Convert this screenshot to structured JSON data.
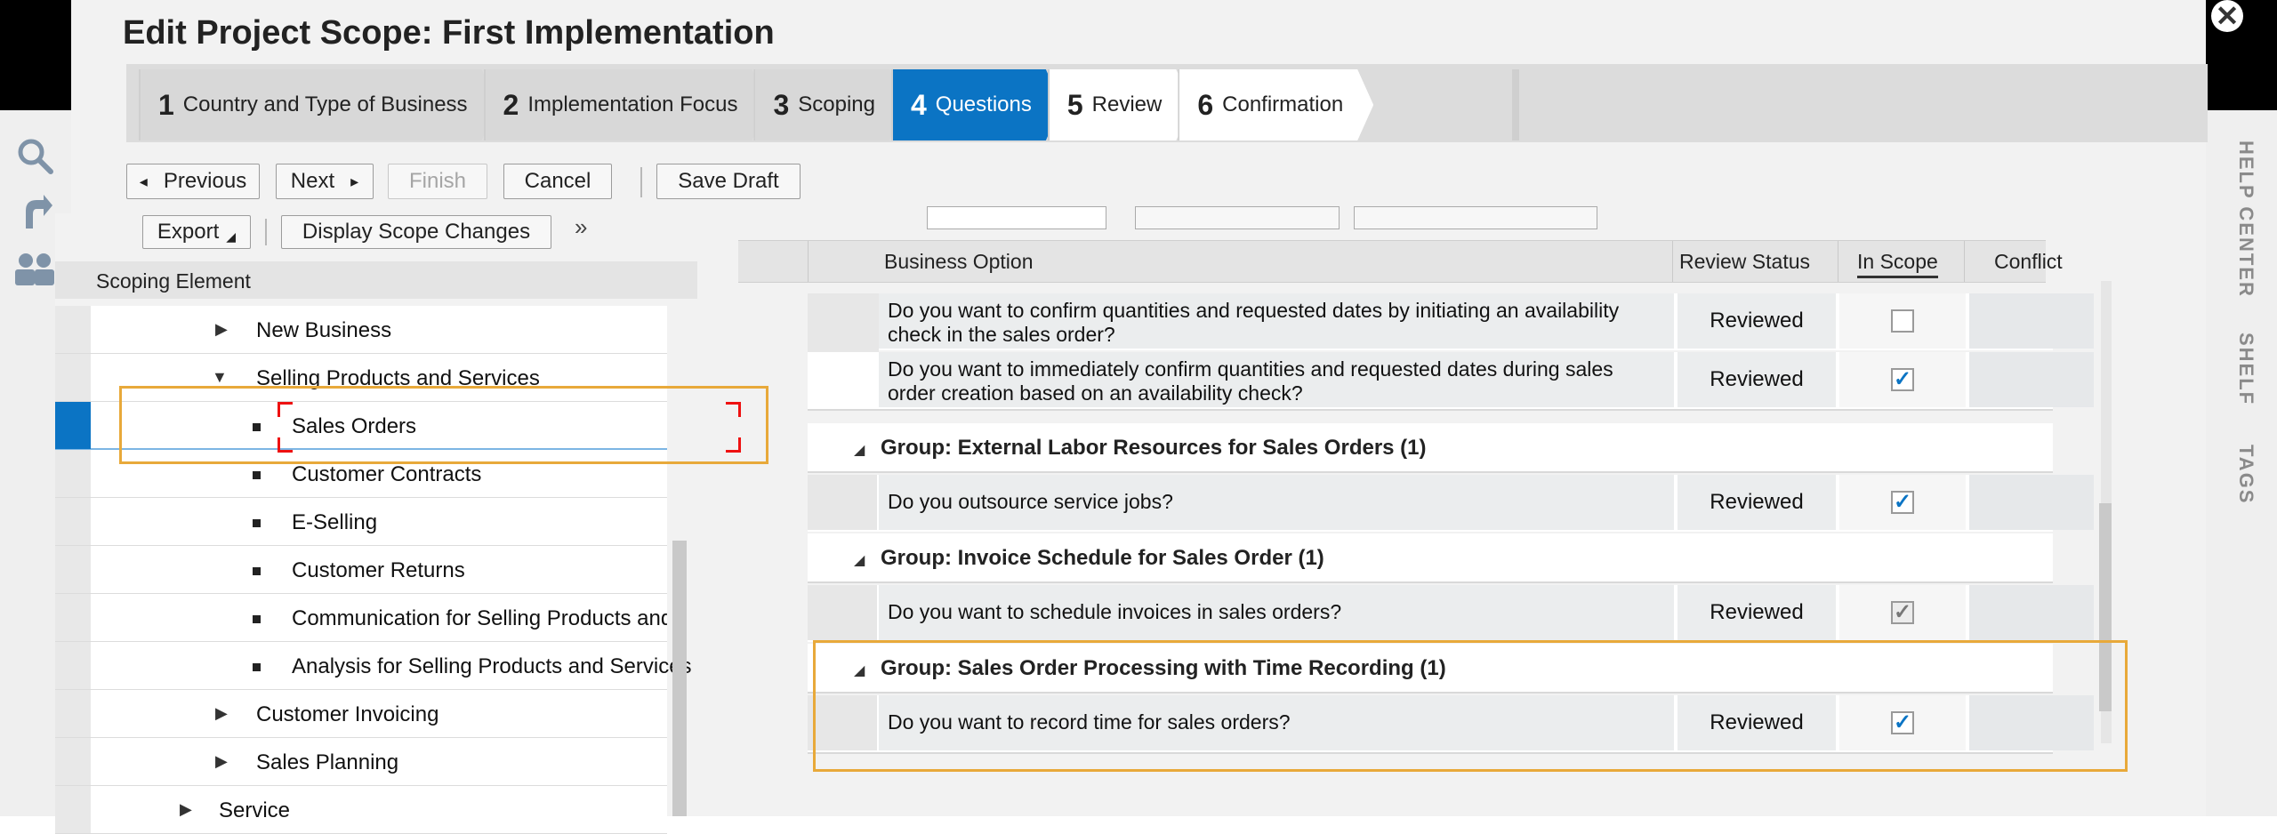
{
  "dialog": {
    "title": "Edit Project Scope: First Implementation",
    "close_icon": "close-icon"
  },
  "roadmap": {
    "steps": [
      {
        "number": "1",
        "label": "Country and Type of Business"
      },
      {
        "number": "2",
        "label": "Implementation Focus"
      },
      {
        "number": "3",
        "label": "Scoping"
      },
      {
        "number": "4",
        "label": "Questions"
      },
      {
        "number": "5",
        "label": "Review"
      },
      {
        "number": "6",
        "label": "Confirmation"
      }
    ],
    "active_step": 4
  },
  "toolbar": {
    "previous_label": "Previous",
    "next_label": "Next",
    "finish_label": "Finish",
    "cancel_label": "Cancel",
    "save_draft_label": "Save Draft"
  },
  "tree": {
    "export_label": "Export",
    "display_changes_label": "Display Scope Changes",
    "collapse_label": "»",
    "header": "Scoping Element",
    "items": [
      {
        "label": "New Business",
        "icon": "caret-right-icon"
      },
      {
        "label": "Selling Products and Services",
        "icon": "caret-down-icon"
      },
      {
        "label": "Sales Orders",
        "icon": "bullet-icon"
      },
      {
        "label": "Customer Contracts",
        "icon": "bullet-icon"
      },
      {
        "label": "E-Selling",
        "icon": "bullet-icon"
      },
      {
        "label": "Customer Returns",
        "icon": "bullet-icon"
      },
      {
        "label": "Communication for Selling Products and Serv",
        "icon": "bullet-icon"
      },
      {
        "label": "Analysis for Selling Products and Services",
        "icon": "bullet-icon"
      },
      {
        "label": "Customer Invoicing",
        "icon": "caret-right-icon"
      },
      {
        "label": "Sales Planning",
        "icon": "caret-right-icon"
      },
      {
        "label": "Service",
        "icon": "caret-right-icon"
      }
    ]
  },
  "grid": {
    "columns": {
      "business_option": "Business Option",
      "review_status": "Review Status",
      "in_scope": "In Scope",
      "conflict": "Conflict"
    },
    "rows": [
      {
        "question": "Do you want to confirm quantities and requested dates by initiating an availability check in the sales order?",
        "status": "Reviewed",
        "in_scope": false
      },
      {
        "question": "Do you want to immediately confirm quantities and requested dates during sales order creation based on an availability check?",
        "status": "Reviewed",
        "in_scope": true
      },
      {
        "group": "Group: External Labor Resources for Sales Orders (1)"
      },
      {
        "question": "Do you outsource service jobs?",
        "status": "Reviewed",
        "in_scope": true
      },
      {
        "group": "Group: Invoice Schedule for Sales Order (1)"
      },
      {
        "question": "Do you want to schedule invoices in sales orders?",
        "status": "Reviewed",
        "in_scope": true,
        "disabled": true
      },
      {
        "group": "Group: Sales Order Processing with Time Recording (1)"
      },
      {
        "question": "Do you want to record time for sales orders?",
        "status": "Reviewed",
        "in_scope": true
      }
    ]
  },
  "side": {
    "left_icons": [
      "search-icon",
      "pointer-icon",
      "users-icon"
    ],
    "right_tabs": [
      "HELP CENTER",
      "SHELF",
      "TAGS"
    ]
  },
  "colors": {
    "accent": "#0b74c4",
    "highlight": "#e8a93a"
  }
}
